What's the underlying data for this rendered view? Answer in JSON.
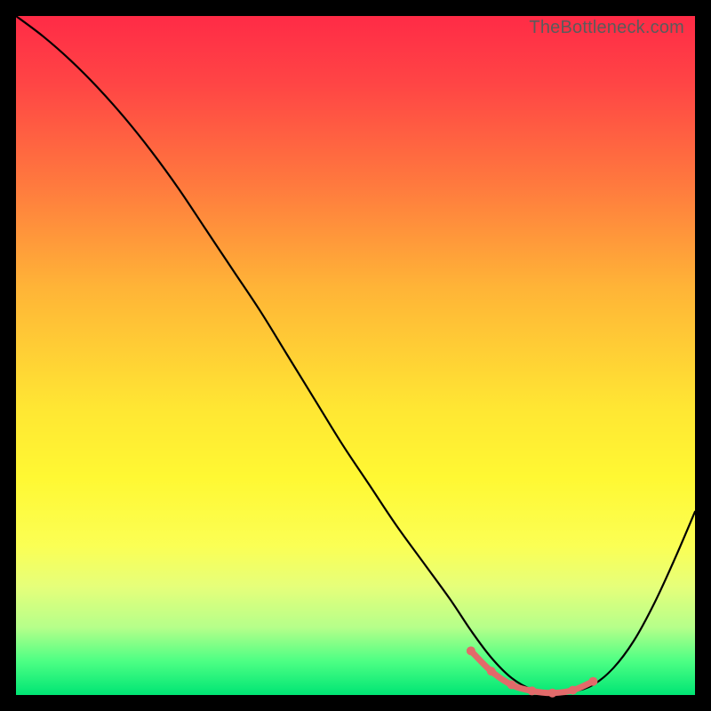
{
  "watermark": "TheBottleneck.com",
  "colors": {
    "curve": "#000000",
    "accent": "#e26a6a",
    "frame": "#000000"
  },
  "chart_data": {
    "type": "line",
    "title": "",
    "xlabel": "",
    "ylabel": "",
    "xlim": [
      0,
      100
    ],
    "ylim": [
      0,
      100
    ],
    "grid": false,
    "legend": false,
    "series": [
      {
        "name": "bottleneck-curve",
        "x": [
          0,
          4,
          8,
          12,
          16,
          20,
          24,
          28,
          32,
          36,
          40,
          44,
          48,
          52,
          56,
          60,
          64,
          67,
          70,
          73,
          76,
          79,
          82,
          85,
          88,
          91,
          94,
          97,
          100
        ],
        "y": [
          100,
          97,
          93.5,
          89.5,
          85,
          80,
          74.5,
          68.5,
          62.5,
          56.5,
          50,
          43.5,
          37,
          31,
          25,
          19.5,
          14,
          9.5,
          5.5,
          2.5,
          0.8,
          0.2,
          0.5,
          1.5,
          4,
          8,
          13.5,
          20,
          27
        ]
      },
      {
        "name": "optimal-range",
        "x": [
          67,
          70,
          73,
          76,
          79,
          82,
          85
        ],
        "y": [
          6.5,
          3.5,
          1.5,
          0.6,
          0.3,
          0.7,
          2.0
        ]
      }
    ],
    "annotations": []
  }
}
